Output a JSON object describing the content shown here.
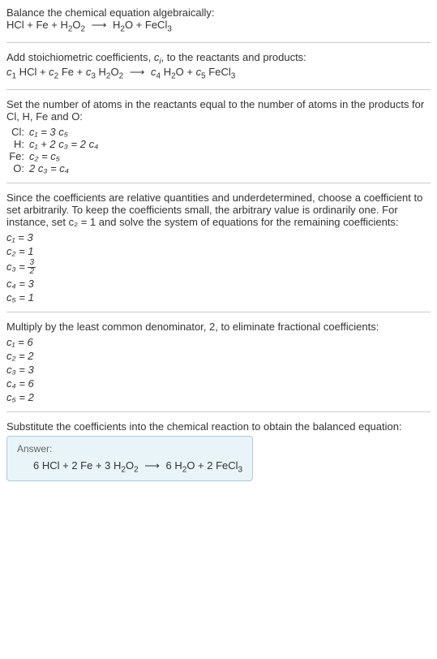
{
  "intro": {
    "line1": "Balance the chemical equation algebraically:",
    "eq_lhs": "HCl + Fe + H",
    "eq_sub1": "2",
    "eq_o": "O",
    "eq_sub2": "2",
    "eq_rhs1": "H",
    "eq_rhs_sub1": "2",
    "eq_rhs_o": "O + FeCl",
    "eq_rhs_sub2": "3"
  },
  "stoich": {
    "line1": "Add stoichiometric coefficients, ",
    "ci": "c",
    "ci_sub": "i",
    "line1b": ", to the reactants and products:",
    "c1": "c",
    "s1": "1",
    "hcl": " HCl + ",
    "c2": "c",
    "s2": "2",
    "fe": " Fe + ",
    "c3": "c",
    "s3": "3",
    "h2o2_h": " H",
    "h2o2_s1": "2",
    "h2o2_o": "O",
    "h2o2_s2": "2",
    "c4": "c",
    "s4": "4",
    "h2o_h": " H",
    "h2o_s": "2",
    "h2o_o": "O + ",
    "c5": "c",
    "s5": "5",
    "fecl3": " FeCl",
    "fecl3_s": "3"
  },
  "atoms": {
    "intro": "Set the number of atoms in the reactants equal to the number of atoms in the products for Cl, H, Fe and O:",
    "rows": [
      {
        "label": "Cl:",
        "eq": "c₁ = 3 c₅"
      },
      {
        "label": "H:",
        "eq": "c₁ + 2 c₃ = 2 c₄"
      },
      {
        "label": "Fe:",
        "eq": "c₂ = c₅"
      },
      {
        "label": "O:",
        "eq": "2 c₃ = c₄"
      }
    ]
  },
  "choose": {
    "text": "Since the coefficients are relative quantities and underdetermined, choose a coefficient to set arbitrarily. To keep the coefficients small, the arbitrary value is ordinarily one. For instance, set c₂ = 1 and solve the system of equations for the remaining coefficients:",
    "coeffs": [
      {
        "lhs": "c₁",
        "rhs": "3",
        "frac": false
      },
      {
        "lhs": "c₂",
        "rhs": "1",
        "frac": false
      },
      {
        "lhs": "c₃",
        "num": "3",
        "den": "2",
        "frac": true
      },
      {
        "lhs": "c₄",
        "rhs": "3",
        "frac": false
      },
      {
        "lhs": "c₅",
        "rhs": "1",
        "frac": false
      }
    ]
  },
  "multiply": {
    "text": "Multiply by the least common denominator, 2, to eliminate fractional coefficients:",
    "coeffs": [
      {
        "lhs": "c₁",
        "rhs": "6"
      },
      {
        "lhs": "c₂",
        "rhs": "2"
      },
      {
        "lhs": "c₃",
        "rhs": "3"
      },
      {
        "lhs": "c₄",
        "rhs": "6"
      },
      {
        "lhs": "c₅",
        "rhs": "2"
      }
    ]
  },
  "substitute": {
    "text": "Substitute the coefficients into the chemical reaction to obtain the balanced equation:"
  },
  "answer": {
    "label": "Answer:",
    "eq_parts": {
      "p1": "6 HCl + 2 Fe + 3 H",
      "s1": "2",
      "p2": "O",
      "s2": "2",
      "p3": "6 H",
      "s3": "2",
      "p4": "O + 2 FeCl",
      "s4": "3"
    }
  },
  "arrow": "⟶"
}
